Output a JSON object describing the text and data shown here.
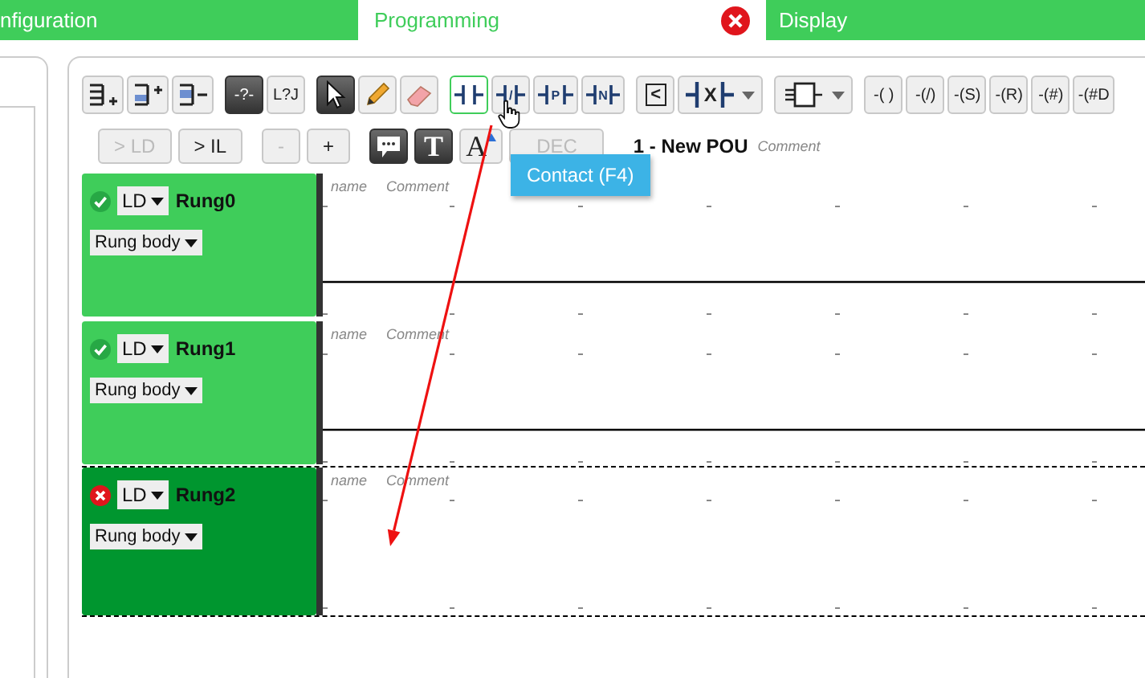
{
  "tabs": [
    {
      "label": "nfiguration",
      "selected": false,
      "closable": false
    },
    {
      "label": "Programming",
      "selected": true,
      "closable": true
    },
    {
      "label": "Display",
      "selected": false,
      "closable": false
    }
  ],
  "toolbar": [
    {
      "buttons": [
        {
          "kind": "rung-add-below",
          "pressed": false,
          "hover": false
        },
        {
          "kind": "rung-add-above",
          "pressed": false,
          "hover": false
        },
        {
          "kind": "rung-delete",
          "pressed": false,
          "hover": false
        }
      ]
    },
    {
      "buttons": [
        {
          "kind": "text",
          "label": "-?-",
          "pressed": true,
          "hover": false
        },
        {
          "kind": "text",
          "label": "L?J",
          "pressed": false,
          "hover": false
        }
      ]
    },
    {
      "buttons": [
        {
          "kind": "select",
          "pressed": true,
          "hover": false
        },
        {
          "kind": "pencil",
          "pressed": false,
          "hover": false
        },
        {
          "kind": "eraser",
          "pressed": false,
          "hover": false
        }
      ]
    },
    {
      "buttons": [
        {
          "kind": "contact",
          "pressed": false,
          "hover": true
        },
        {
          "kind": "contact",
          "label": "/",
          "pressed": false,
          "hover": false
        },
        {
          "kind": "contact",
          "label": "P",
          "pressed": false,
          "hover": false
        },
        {
          "kind": "contact",
          "label": "N",
          "pressed": false,
          "hover": false
        }
      ]
    },
    {
      "buttons": [
        {
          "kind": "compare",
          "label": "<",
          "pressed": false,
          "hover": false
        },
        {
          "kind": "function",
          "label": "X",
          "pressed": false,
          "hover": false
        }
      ]
    },
    {
      "buttons": [
        {
          "kind": "block",
          "pressed": false,
          "hover": false
        }
      ]
    },
    {
      "buttons": [
        {
          "kind": "text",
          "label": "-( )",
          "pressed": false,
          "hover": false
        },
        {
          "kind": "text",
          "label": "-(/)",
          "pressed": false,
          "hover": false
        },
        {
          "kind": "text",
          "label": "-(S)",
          "pressed": false,
          "hover": false
        },
        {
          "kind": "text",
          "label": "-(R)",
          "pressed": false,
          "hover": false
        },
        {
          "kind": "text",
          "label": "-(#)",
          "pressed": false,
          "hover": false
        },
        {
          "kind": "text",
          "label": "-(#D",
          "pressed": false,
          "hover": false
        }
      ]
    }
  ],
  "toolbar2": [
    {
      "buttons": [
        {
          "kind": "text",
          "label": "> LD",
          "pressed": false,
          "disabled": true
        },
        {
          "kind": "text",
          "label": "> IL",
          "pressed": false,
          "disabled": false
        }
      ]
    },
    {
      "buttons": [
        {
          "kind": "text",
          "label": "-",
          "pressed": false,
          "disabled": true
        },
        {
          "kind": "text",
          "label": "+",
          "pressed": false,
          "disabled": false
        }
      ]
    },
    {
      "buttons": [
        {
          "kind": "comment",
          "pressed": true,
          "disabled": false
        },
        {
          "kind": "text",
          "label": "T",
          "pressed": true,
          "disabled": false
        },
        {
          "kind": "font-size",
          "label": "A",
          "pressed": false,
          "disabled": false
        },
        {
          "kind": "text",
          "label": "DEC",
          "pressed": false,
          "disabled": true
        }
      ]
    }
  ],
  "pou": {
    "title": "1 - New POU",
    "comment": "Comment"
  },
  "tooltip": "Contact (F4)",
  "rungs": [
    {
      "name": "Rung0",
      "error": false,
      "language": "LD",
      "body": "Rung body",
      "selected": false,
      "name_label": "name",
      "comment_label": "Comment"
    },
    {
      "name": "Rung1",
      "error": false,
      "language": "LD",
      "body": "Rung body",
      "selected": false,
      "name_label": "name",
      "comment_label": "Comment"
    },
    {
      "name": "Rung2",
      "error": true,
      "language": "LD",
      "body": "Rung body",
      "selected": true,
      "name_label": "name",
      "comment_label": "Comment"
    }
  ]
}
